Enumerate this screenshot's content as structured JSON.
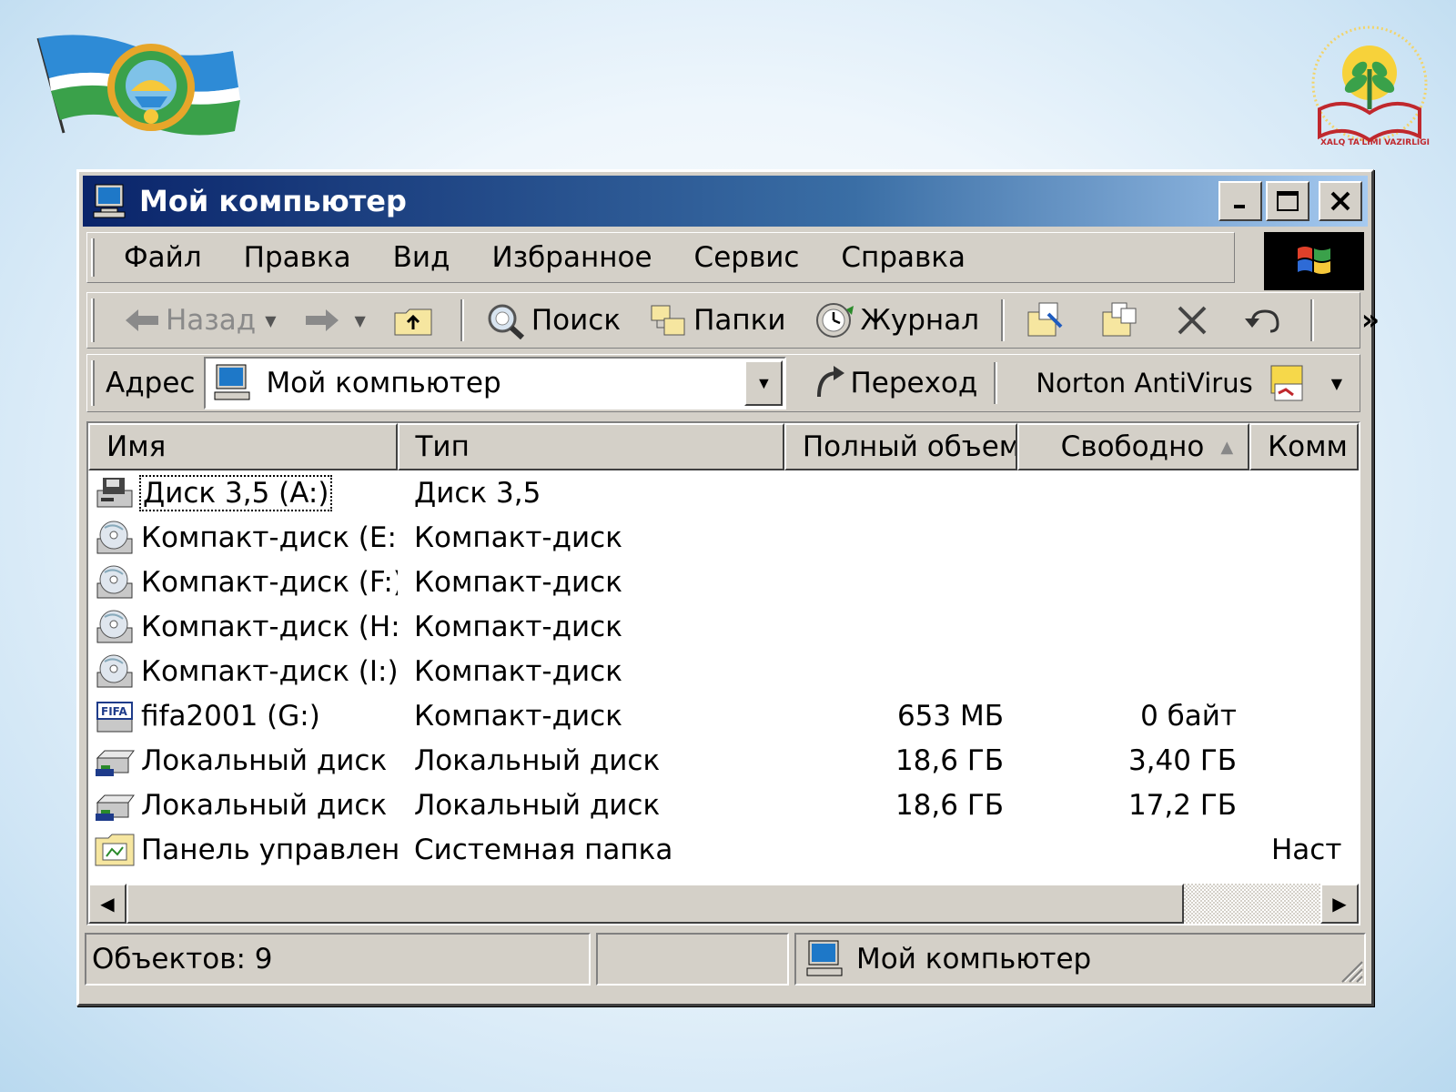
{
  "window": {
    "title": "Мой компьютер"
  },
  "menubar": {
    "items": [
      "Файл",
      "Правка",
      "Вид",
      "Избранное",
      "Сервис",
      "Справка"
    ]
  },
  "toolbar": {
    "back_label": "Назад",
    "search_label": "Поиск",
    "folders_label": "Папки",
    "history_label": "Журнал",
    "more_label": "»"
  },
  "addressbar": {
    "label": "Адрес",
    "value": "Мой компьютер",
    "go_label": "Переход",
    "norton_label": "Norton AntiVirus"
  },
  "list": {
    "columns": [
      "Имя",
      "Тип",
      "Полный объем",
      "Свободно",
      "Комм"
    ],
    "sort_indicator": "▲",
    "rows": [
      {
        "name": "Диск 3,5 (A:)",
        "type": "Диск 3,5",
        "size": "",
        "free": "",
        "comment": "",
        "icon": "floppy-drive-icon"
      },
      {
        "name": "Компакт-диск (E:)",
        "type": "Компакт-диск",
        "size": "",
        "free": "",
        "comment": "",
        "icon": "cd-drive-icon"
      },
      {
        "name": "Компакт-диск (F:)",
        "type": "Компакт-диск",
        "size": "",
        "free": "",
        "comment": "",
        "icon": "cd-drive-icon"
      },
      {
        "name": "Компакт-диск (H:)",
        "type": "Компакт-диск",
        "size": "",
        "free": "",
        "comment": "",
        "icon": "cd-drive-icon"
      },
      {
        "name": "Компакт-диск (I:)",
        "type": "Компакт-диск",
        "size": "",
        "free": "",
        "comment": "",
        "icon": "cd-drive-icon"
      },
      {
        "name": "fifa2001 (G:)",
        "type": "Компакт-диск",
        "size": "653 МБ",
        "free": "0 байт",
        "comment": "",
        "icon": "fifa-cd-icon"
      },
      {
        "name": "Локальный диск ...",
        "type": "Локальный диск",
        "size": "18,6 ГБ",
        "free": "3,40 ГБ",
        "comment": "",
        "icon": "hard-drive-icon"
      },
      {
        "name": "Локальный диск ...",
        "type": "Локальный диск",
        "size": "18,6 ГБ",
        "free": "17,2 ГБ",
        "comment": "",
        "icon": "hard-drive-icon"
      },
      {
        "name": "Панель управлен...",
        "type": "Системная папка",
        "size": "",
        "free": "",
        "comment": "Наст",
        "icon": "control-panel-folder-icon"
      }
    ]
  },
  "statusbar": {
    "objects": "Объектов: 9",
    "location": "Мой компьютер"
  },
  "logos": {
    "right_text": "XALQ TA'LIMI VAZIRLIGI",
    "right_arc_text": "O'ZBEKISTON RESPUBLIKASI"
  },
  "colors": {
    "titlebar_start": "#0a246a",
    "titlebar_end": "#a6caf0",
    "face": "#d4d0c8"
  }
}
